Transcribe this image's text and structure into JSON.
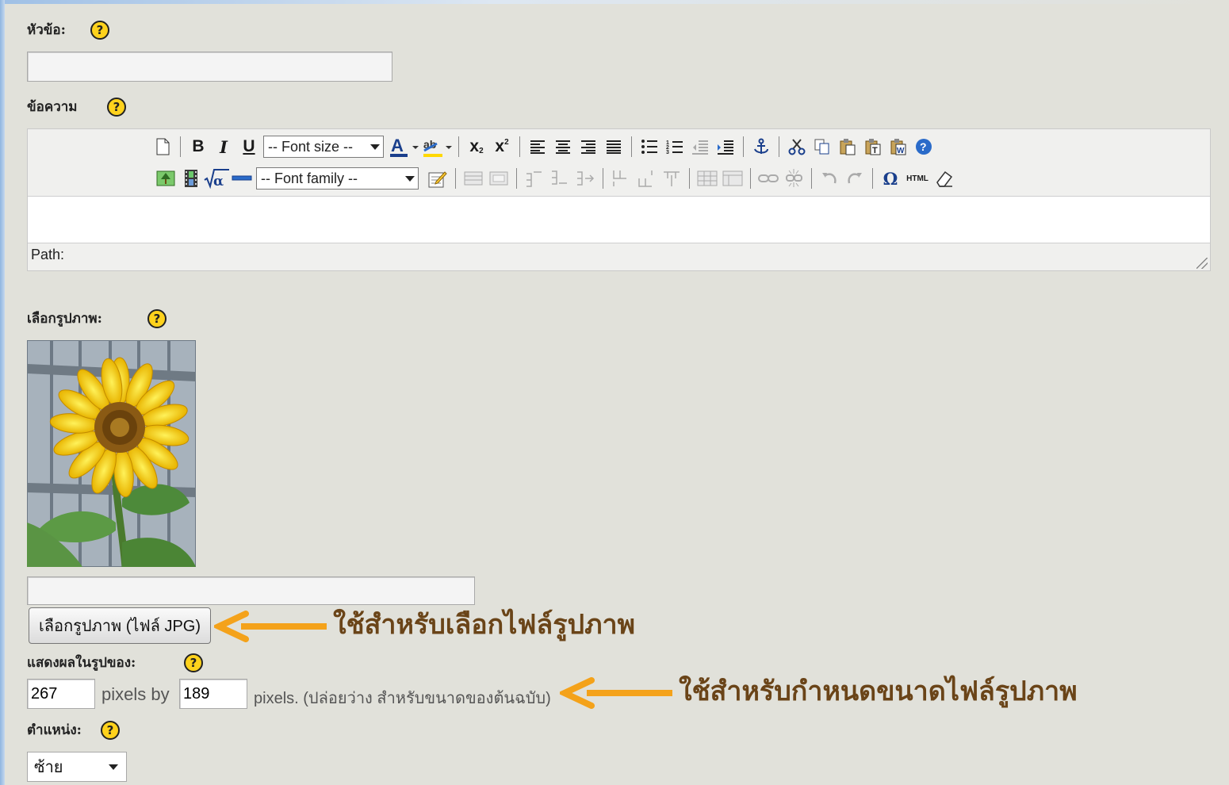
{
  "form": {
    "title_label": "หัวข้อ:",
    "message_label": "ข้อความ",
    "choose_image_label": "เลือกรูปภาพ:",
    "display_size_label": "แสดงผลในรูปของ:",
    "position_label": "ตำแหน่ง:",
    "help_glyph": "?",
    "title_value": "",
    "image_path_value": ""
  },
  "editor": {
    "font_size_placeholder": "-- Font size --",
    "font_family_placeholder": "-- Font family --",
    "path_label": "Path:",
    "toolbar_row1": [
      "new-document",
      "bold",
      "italic",
      "underline",
      "font-size",
      "font-color",
      "highlight",
      "subscript",
      "superscript",
      "align-left",
      "align-center",
      "align-right",
      "align-justify",
      "bullet-list",
      "numbered-list",
      "outdent",
      "indent",
      "anchor",
      "cut",
      "copy",
      "paste",
      "paste-text",
      "paste-word",
      "help"
    ],
    "toolbar_row2": [
      "image",
      "media",
      "math",
      "horizontal-rule",
      "font-family",
      "edit",
      "row-before",
      "row-after",
      "insert-row",
      "insert-col",
      "delete-col",
      "cell-props",
      "merge",
      "split",
      "table",
      "table-props",
      "link",
      "unlink",
      "undo",
      "redo",
      "special-char",
      "html",
      "cleanup"
    ]
  },
  "image": {
    "choose_button_label": "เลือกรูปภาพ (ไฟล์ JPG)",
    "width_value": "267",
    "height_value": "189",
    "pixels_by": "pixels by",
    "pixels_note": "pixels. (ปล่อยว่าง สำหรับขนาดของต้นฉบับ)"
  },
  "position_select": {
    "selected": "ซ้าย"
  },
  "annotations": {
    "choose_image_hint": "ใช้สำหรับเลือกไฟล์รูปภาพ",
    "size_hint": "ใช้สำหรับกำหนดขนาดไฟล์รูปภาพ"
  },
  "colors": {
    "background": "#e1e1da",
    "help_icon": "#ffd21c",
    "arrow": "#f4a21a",
    "annotation_text": "#6a4418"
  }
}
